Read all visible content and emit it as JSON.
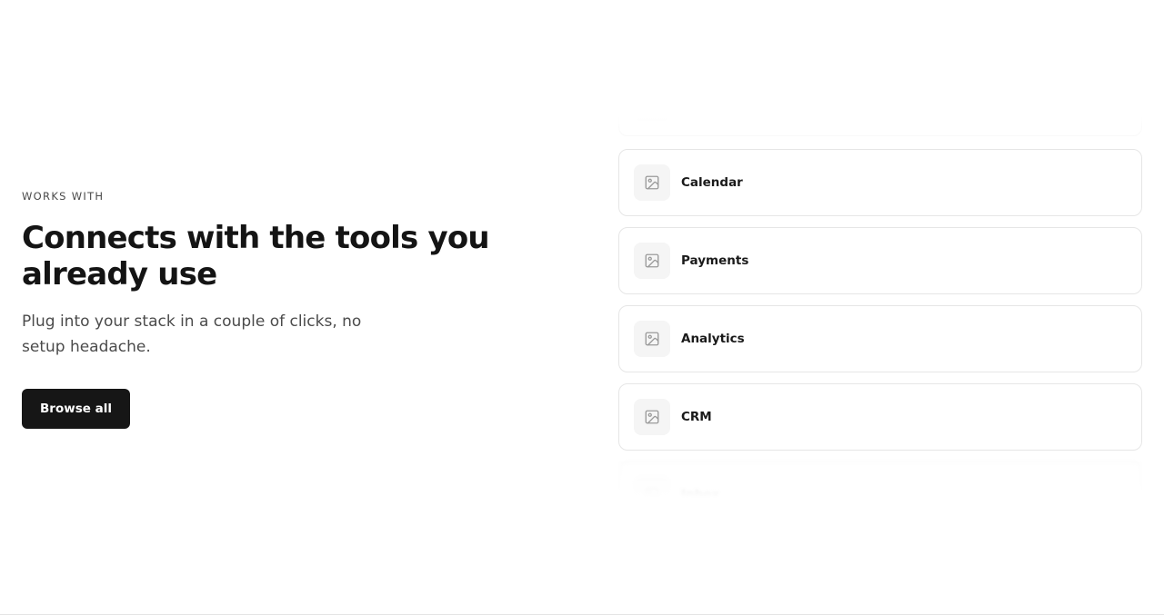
{
  "hero": {
    "eyebrow": "WORKS WITH",
    "title": "Connects with the tools you already use",
    "subtitle": "Plug into your stack in a couple of clicks, no setup headache.",
    "cta_label": "Browse all"
  },
  "integrations": {
    "items": [
      {
        "label": "Calendar",
        "icon": "image-placeholder-icon"
      },
      {
        "label": "Payments",
        "icon": "image-placeholder-icon"
      },
      {
        "label": "Analytics",
        "icon": "image-placeholder-icon"
      },
      {
        "label": "CRM",
        "icon": "image-placeholder-icon"
      }
    ],
    "partial_bottom_label": "Inbox"
  }
}
